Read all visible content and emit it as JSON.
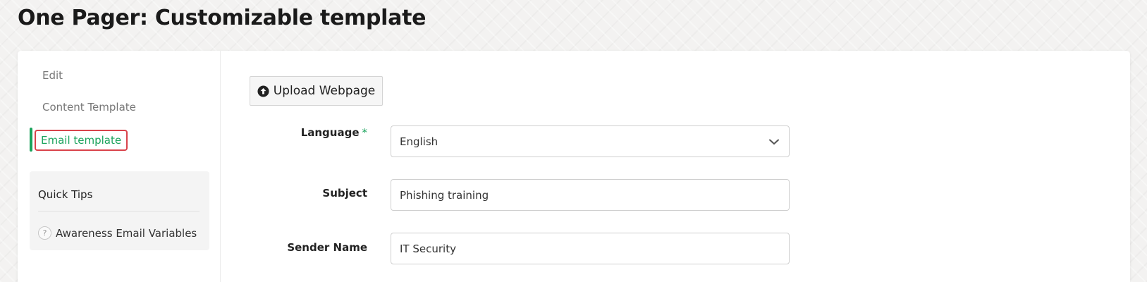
{
  "page": {
    "title": "One Pager: Customizable template"
  },
  "sidebar": {
    "items": [
      {
        "label": "Edit"
      },
      {
        "label": "Content Template"
      },
      {
        "label": "Email template",
        "active": true
      }
    ],
    "tips": {
      "title": "Quick Tips",
      "link_label": "Awareness Email Variables",
      "link_icon": "question-circle-icon"
    }
  },
  "main": {
    "upload_button_label": "Upload Webpage",
    "upload_icon": "upload-circle-icon",
    "form": {
      "language": {
        "label": "Language",
        "required_mark": "*",
        "value": "English"
      },
      "subject": {
        "label": "Subject",
        "value": "Phishing training"
      },
      "sender_name": {
        "label": "Sender Name",
        "value": "IT Security"
      }
    }
  },
  "colors": {
    "accent": "#1aa35c",
    "highlight_border": "#d9434b"
  }
}
